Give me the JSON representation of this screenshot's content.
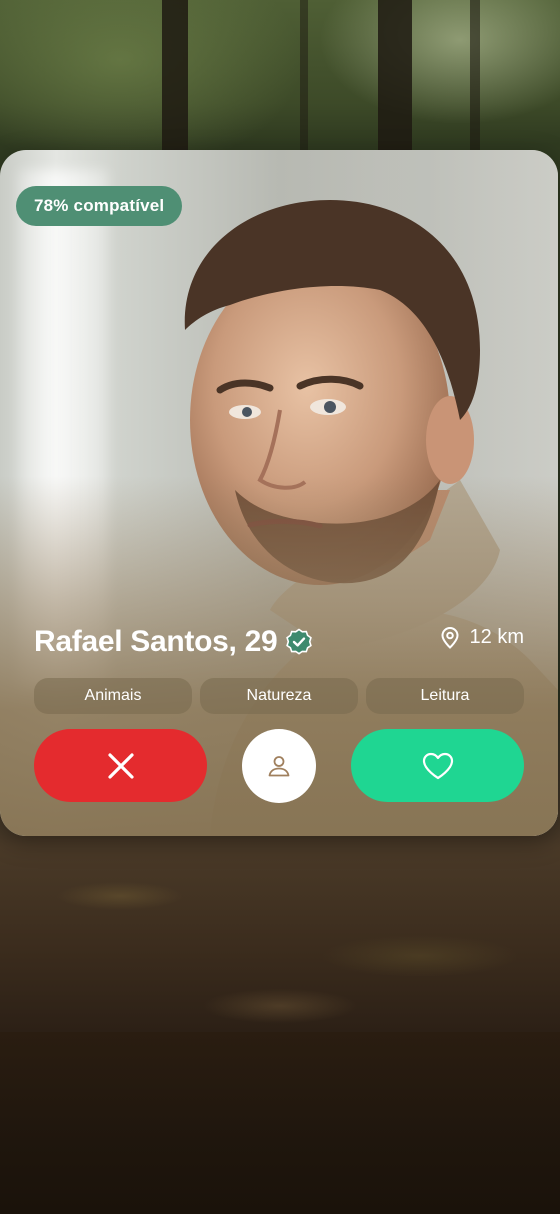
{
  "profile": {
    "compatibility": "78% compatível",
    "name_age": "Rafael Santos, 29",
    "distance": "12 km",
    "tags": [
      "Animais",
      "Natureza",
      "Leitura"
    ]
  },
  "icons": {
    "verified": "verified-badge-icon",
    "location": "map-pin-icon",
    "reject": "close-x-icon",
    "profile": "person-icon",
    "like": "heart-icon"
  },
  "colors": {
    "compat_badge": "#4f8f74",
    "reject_button": "#e42b2e",
    "like_button": "#1fd692",
    "profile_button": "#ffffff",
    "verified_badge": "#3e8a6e"
  }
}
